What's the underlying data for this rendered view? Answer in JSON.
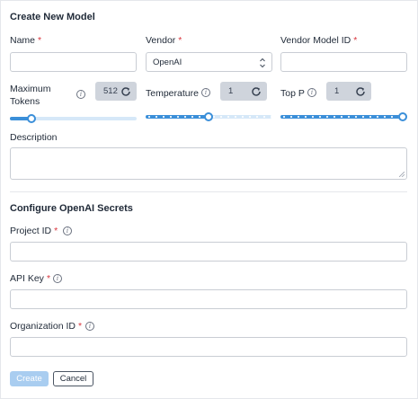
{
  "form": {
    "title": "Create New Model",
    "fields": {
      "name": {
        "label": "Name",
        "required": "*",
        "value": ""
      },
      "vendor": {
        "label": "Vendor",
        "required": "*",
        "selected": "OpenAI"
      },
      "vendor_model_id": {
        "label": "Vendor Model ID",
        "required": "*",
        "value": ""
      }
    },
    "params": {
      "max_tokens": {
        "label": "Maximum Tokens",
        "value": "512",
        "level": 0.16
      },
      "temperature": {
        "label": "Temperature",
        "value": "1",
        "level": 0.5
      },
      "top_p": {
        "label": "Top P",
        "value": "1",
        "level": 1.0
      }
    },
    "description": {
      "label": "Description",
      "value": ""
    }
  },
  "secrets": {
    "title": "Configure OpenAI Secrets",
    "project_id": {
      "label": "Project ID",
      "required": "*",
      "value": ""
    },
    "api_key": {
      "label": "API Key",
      "required": "*",
      "value": ""
    },
    "organization_id": {
      "label": "Organization ID",
      "required": "*",
      "value": ""
    }
  },
  "actions": {
    "create": "Create",
    "cancel": "Cancel"
  },
  "icons": {
    "info": "info-icon",
    "refresh": "refresh-icon",
    "select": "chevron-up-down-icon"
  },
  "colors": {
    "accent": "#3b8fd9",
    "required": "#d9363e",
    "create_disabled": "#a9cdf0"
  }
}
